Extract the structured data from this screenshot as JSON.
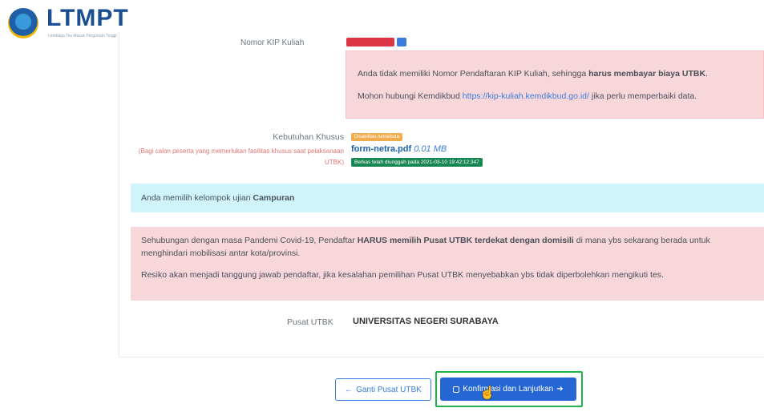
{
  "header": {
    "logo_text": "LTMPT",
    "logo_subtitle": "Lembaga Tes Masuk Perguruan Tinggi"
  },
  "kip": {
    "label": "Nomor KIP Kuliah",
    "alert_line1_pre": "Anda tidak memiliki Nomor Pendaftaran KIP Kuliah, sehingga ",
    "alert_line1_bold": "harus membayar biaya UTBK",
    "alert_line1_post": ".",
    "alert_line2_pre": "Mohon hubungi Kemdikbud ",
    "alert_link": "https://kip-kuliah.kemdikbud.go.id/",
    "alert_line2_post": " jika perlu memperbaiki data."
  },
  "kebutuhan_khusus": {
    "label": "Kebutuhan Khusus",
    "note": "(Bagi calon peserta yang memerlukan fasilitas khusus saat pelaksanaan UTBK)",
    "badge": "Disabilitas netra/buta",
    "file_name": "form-netra.pdf",
    "file_size": "0.01 MB",
    "upload_status": "Berkas telah diunggah pada 2021-03-10 19:42:12.347"
  },
  "kelompok": {
    "text": "Anda memilih kelompok ujian ",
    "value": "Campuran"
  },
  "covid_alert": {
    "p1_pre": "Sehubungan dengan masa Pandemi Covid-19, Pendaftar ",
    "p1_bold": "HARUS memilih Pusat UTBK terdekat dengan domisili",
    "p1_post": " di mana ybs sekarang berada untuk menghindari mobilisasi antar kota/provinsi.",
    "p2": "Resiko akan menjadi tanggung jawab pendaftar, jika kesalahan pemilihan Pusat UTBK menyebabkan ybs tidak diperbolehkan mengikuti tes."
  },
  "pusat": {
    "label": "Pusat UTBK",
    "value": "UNIVERSITAS NEGERI SURABAYA"
  },
  "buttons": {
    "back_label": "Ganti Pusat UTBK",
    "confirm_label": "Konfirmasi dan Lanjutkan"
  },
  "colors": {
    "primary": "#2466d3",
    "danger_bg": "#f8d7da",
    "info_bg": "#cff4fc",
    "highlight": "#22b14c"
  }
}
